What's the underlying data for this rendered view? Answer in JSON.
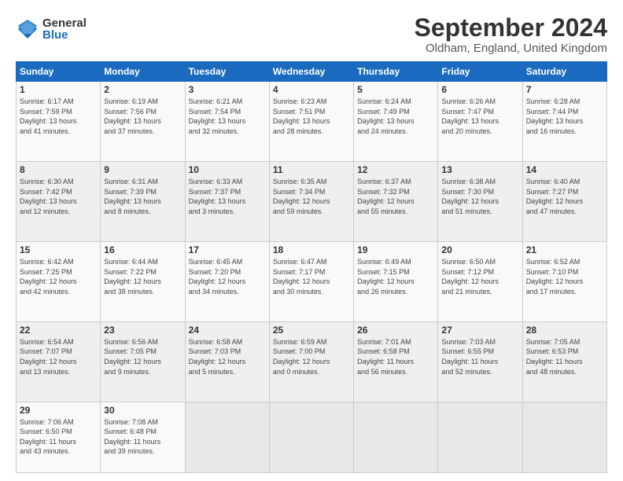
{
  "logo": {
    "general": "General",
    "blue": "Blue"
  },
  "title": "September 2024",
  "location": "Oldham, England, United Kingdom",
  "headers": [
    "Sunday",
    "Monday",
    "Tuesday",
    "Wednesday",
    "Thursday",
    "Friday",
    "Saturday"
  ],
  "weeks": [
    [
      {
        "num": "1",
        "info": "Sunrise: 6:17 AM\nSunset: 7:59 PM\nDaylight: 13 hours\nand 41 minutes."
      },
      {
        "num": "2",
        "info": "Sunrise: 6:19 AM\nSunset: 7:56 PM\nDaylight: 13 hours\nand 37 minutes."
      },
      {
        "num": "3",
        "info": "Sunrise: 6:21 AM\nSunset: 7:54 PM\nDaylight: 13 hours\nand 32 minutes."
      },
      {
        "num": "4",
        "info": "Sunrise: 6:23 AM\nSunset: 7:51 PM\nDaylight: 13 hours\nand 28 minutes."
      },
      {
        "num": "5",
        "info": "Sunrise: 6:24 AM\nSunset: 7:49 PM\nDaylight: 13 hours\nand 24 minutes."
      },
      {
        "num": "6",
        "info": "Sunrise: 6:26 AM\nSunset: 7:47 PM\nDaylight: 13 hours\nand 20 minutes."
      },
      {
        "num": "7",
        "info": "Sunrise: 6:28 AM\nSunset: 7:44 PM\nDaylight: 13 hours\nand 16 minutes."
      }
    ],
    [
      {
        "num": "8",
        "info": "Sunrise: 6:30 AM\nSunset: 7:42 PM\nDaylight: 13 hours\nand 12 minutes."
      },
      {
        "num": "9",
        "info": "Sunrise: 6:31 AM\nSunset: 7:39 PM\nDaylight: 13 hours\nand 8 minutes."
      },
      {
        "num": "10",
        "info": "Sunrise: 6:33 AM\nSunset: 7:37 PM\nDaylight: 13 hours\nand 3 minutes."
      },
      {
        "num": "11",
        "info": "Sunrise: 6:35 AM\nSunset: 7:34 PM\nDaylight: 12 hours\nand 59 minutes."
      },
      {
        "num": "12",
        "info": "Sunrise: 6:37 AM\nSunset: 7:32 PM\nDaylight: 12 hours\nand 55 minutes."
      },
      {
        "num": "13",
        "info": "Sunrise: 6:38 AM\nSunset: 7:30 PM\nDaylight: 12 hours\nand 51 minutes."
      },
      {
        "num": "14",
        "info": "Sunrise: 6:40 AM\nSunset: 7:27 PM\nDaylight: 12 hours\nand 47 minutes."
      }
    ],
    [
      {
        "num": "15",
        "info": "Sunrise: 6:42 AM\nSunset: 7:25 PM\nDaylight: 12 hours\nand 42 minutes."
      },
      {
        "num": "16",
        "info": "Sunrise: 6:44 AM\nSunset: 7:22 PM\nDaylight: 12 hours\nand 38 minutes."
      },
      {
        "num": "17",
        "info": "Sunrise: 6:45 AM\nSunset: 7:20 PM\nDaylight: 12 hours\nand 34 minutes."
      },
      {
        "num": "18",
        "info": "Sunrise: 6:47 AM\nSunset: 7:17 PM\nDaylight: 12 hours\nand 30 minutes."
      },
      {
        "num": "19",
        "info": "Sunrise: 6:49 AM\nSunset: 7:15 PM\nDaylight: 12 hours\nand 26 minutes."
      },
      {
        "num": "20",
        "info": "Sunrise: 6:50 AM\nSunset: 7:12 PM\nDaylight: 12 hours\nand 21 minutes."
      },
      {
        "num": "21",
        "info": "Sunrise: 6:52 AM\nSunset: 7:10 PM\nDaylight: 12 hours\nand 17 minutes."
      }
    ],
    [
      {
        "num": "22",
        "info": "Sunrise: 6:54 AM\nSunset: 7:07 PM\nDaylight: 12 hours\nand 13 minutes."
      },
      {
        "num": "23",
        "info": "Sunrise: 6:56 AM\nSunset: 7:05 PM\nDaylight: 12 hours\nand 9 minutes."
      },
      {
        "num": "24",
        "info": "Sunrise: 6:58 AM\nSunset: 7:03 PM\nDaylight: 12 hours\nand 5 minutes."
      },
      {
        "num": "25",
        "info": "Sunrise: 6:59 AM\nSunset: 7:00 PM\nDaylight: 12 hours\nand 0 minutes."
      },
      {
        "num": "26",
        "info": "Sunrise: 7:01 AM\nSunset: 6:58 PM\nDaylight: 11 hours\nand 56 minutes."
      },
      {
        "num": "27",
        "info": "Sunrise: 7:03 AM\nSunset: 6:55 PM\nDaylight: 11 hours\nand 52 minutes."
      },
      {
        "num": "28",
        "info": "Sunrise: 7:05 AM\nSunset: 6:53 PM\nDaylight: 11 hours\nand 48 minutes."
      }
    ],
    [
      {
        "num": "29",
        "info": "Sunrise: 7:06 AM\nSunset: 6:50 PM\nDaylight: 11 hours\nand 43 minutes."
      },
      {
        "num": "30",
        "info": "Sunrise: 7:08 AM\nSunset: 6:48 PM\nDaylight: 11 hours\nand 39 minutes."
      },
      {
        "num": "",
        "info": ""
      },
      {
        "num": "",
        "info": ""
      },
      {
        "num": "",
        "info": ""
      },
      {
        "num": "",
        "info": ""
      },
      {
        "num": "",
        "info": ""
      }
    ]
  ]
}
